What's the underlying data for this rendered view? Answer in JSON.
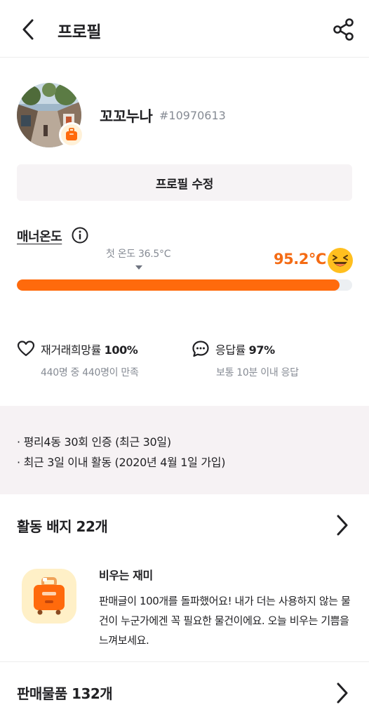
{
  "header": {
    "title": "프로필",
    "back_icon": "chevron-left-icon",
    "share_icon": "share-icon"
  },
  "profile": {
    "nickname": "꼬꼬누나",
    "user_id": "#10970613",
    "badge_icon": "suitcase-icon",
    "edit_button_label": "프로필 수정"
  },
  "manner": {
    "label": "매너온도",
    "info_icon": "info-icon",
    "first_temp_label": "첫 온도 36.5°C",
    "current_temp": "95.2°C",
    "temp_value": 95.2,
    "temp_fill_fraction": 0.963,
    "face_icon": "laughing-face-icon",
    "accent_color": "#ff6a0c"
  },
  "stats": [
    {
      "icon": "heart-icon",
      "label": "재거래희망률",
      "value": "100%",
      "sub": "440명 중 440명이 만족"
    },
    {
      "icon": "chat-bubble-icon",
      "label": "응답률",
      "value": "97%",
      "sub": "보통 10분 이내 응답"
    }
  ],
  "info_box": {
    "lines": [
      "· 평리4동 30회 인증 (최근 30일)",
      "· 최근 3일 이내 활동 (2020년 4월 1일 가입)"
    ]
  },
  "badges": {
    "title": "활동 배지 22개",
    "featured": {
      "icon": "suitcase-icon",
      "name": "비우는 재미",
      "description": "판매글이 100개를 돌파했어요! 내가 더는 사용하지 않는 물건이 누군가에겐 꼭 필요한 물건이에요. 오늘 비우는 기쁨을 느껴보세요."
    }
  },
  "sales": {
    "title": "판매물품 132개"
  }
}
